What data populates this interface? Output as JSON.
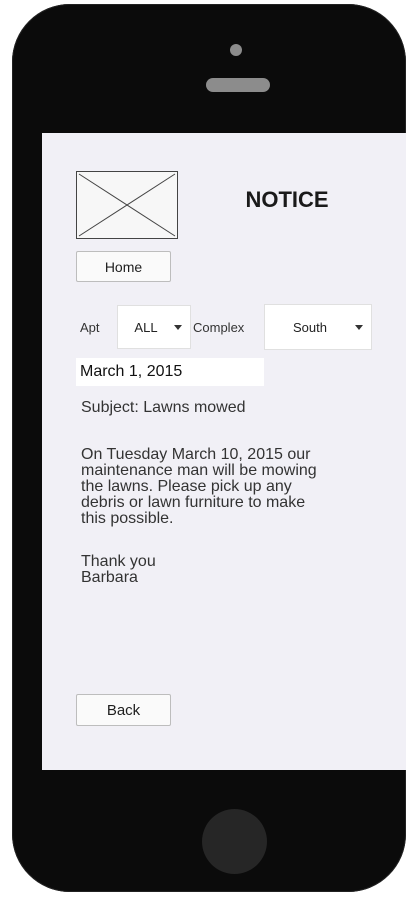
{
  "header": {
    "title": "NOTICE",
    "logo_icon": "image-placeholder-icon"
  },
  "nav": {
    "home_label": "Home",
    "back_label": "Back"
  },
  "filters": {
    "apt_label": "Apt",
    "apt_value": "ALL",
    "complex_label": "Complex",
    "complex_value": "South"
  },
  "notice": {
    "date": "March 1, 2015",
    "subject": "Subject: Lawns mowed",
    "body_lines": [
      "On Tuesday March 10, 2015 our",
      "maintenance man will be mowing",
      "the lawns.  Please pick up any",
      "debris or lawn furniture to make",
      "this possible."
    ],
    "signoff_lines": [
      "Thank you",
      "Barbara"
    ]
  },
  "colors": {
    "screen_bg": "#f1f0f6",
    "device": "#0b0b0b"
  }
}
